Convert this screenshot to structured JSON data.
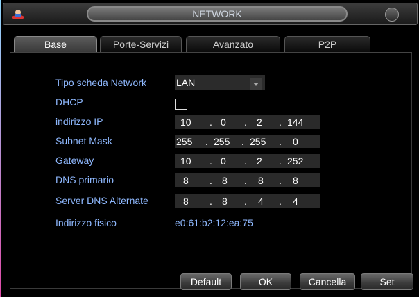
{
  "window": {
    "title": "NETWORK"
  },
  "tabs": [
    {
      "label": "Base",
      "active": true
    },
    {
      "label": "Porte-Servizi",
      "active": false
    },
    {
      "label": "Avanzato",
      "active": false
    },
    {
      "label": "P2P",
      "active": false
    }
  ],
  "form": {
    "network_type": {
      "label": "Tipo scheda Network",
      "value": "LAN"
    },
    "dhcp": {
      "label": "DHCP",
      "checked": false
    },
    "ip_address": {
      "label": "indirizzo IP",
      "octets": [
        "10",
        "0",
        "2",
        "144"
      ]
    },
    "subnet_mask": {
      "label": "Subnet Mask",
      "octets": [
        "255",
        "255",
        "255",
        "0"
      ]
    },
    "gateway": {
      "label": "Gateway",
      "octets": [
        "10",
        "0",
        "2",
        "252"
      ]
    },
    "dns_primary": {
      "label": "DNS primario",
      "octets": [
        "8",
        "8",
        "8",
        "8"
      ]
    },
    "dns_alternate": {
      "label": "Server DNS Alternate",
      "octets": [
        "8",
        "8",
        "4",
        "4"
      ]
    },
    "mac": {
      "label": "Indirizzo fisico",
      "value": "e0:61:b2:12:ea:75"
    }
  },
  "buttons": {
    "default": "Default",
    "ok": "OK",
    "cancel": "Cancella",
    "set": "Set"
  },
  "colors": {
    "label": "#8fb9ff",
    "background": "#000000",
    "field": "#2a2a2a"
  },
  "separator": "."
}
